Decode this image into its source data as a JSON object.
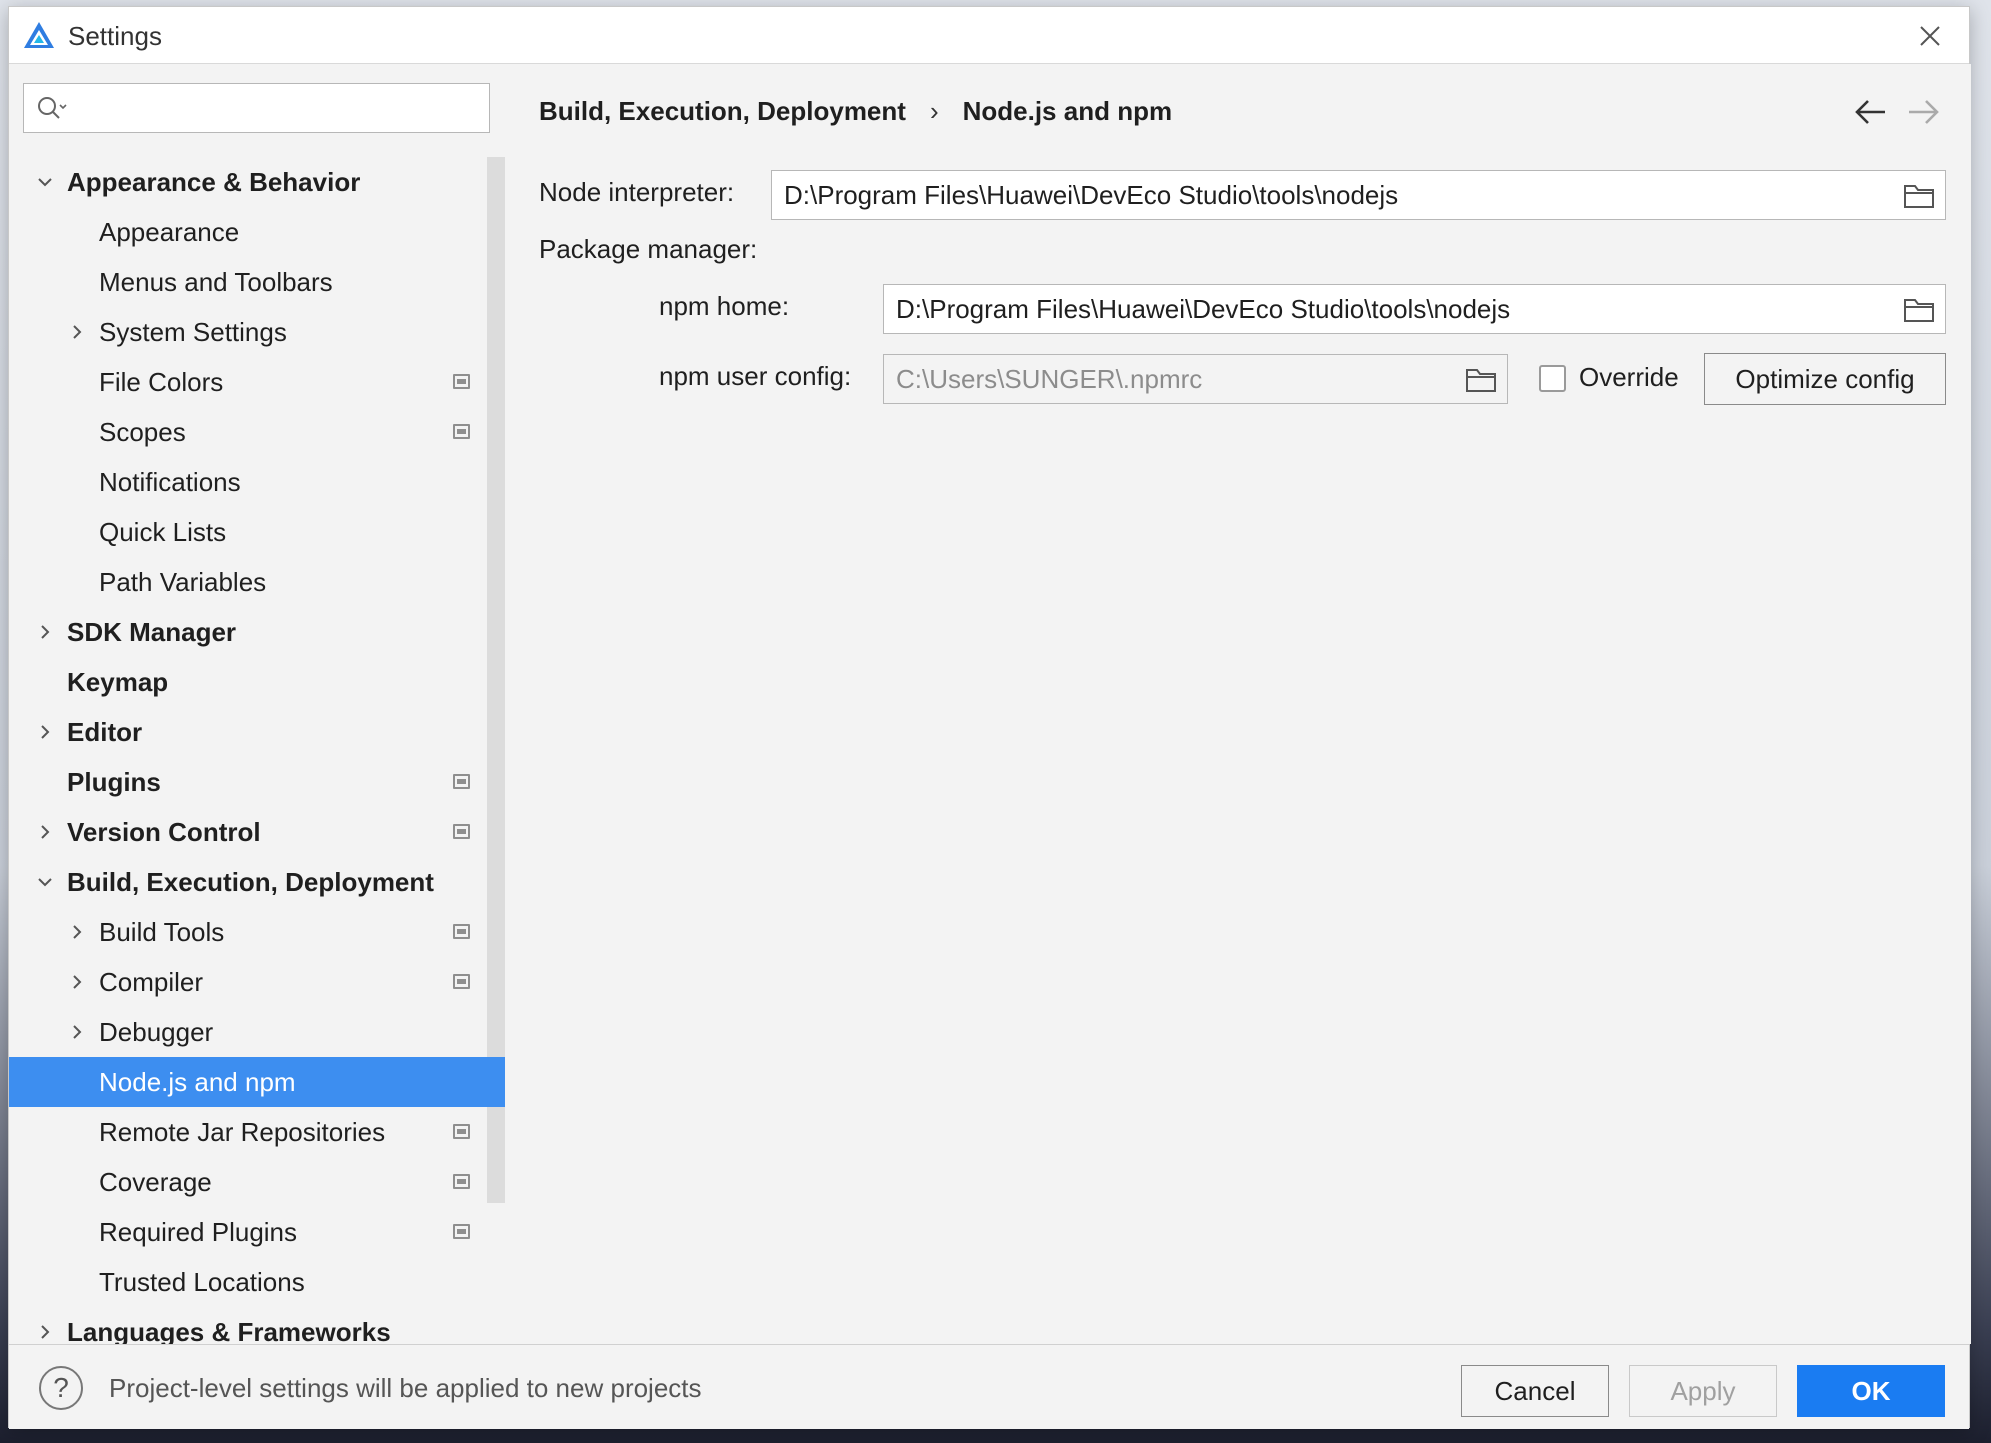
{
  "window": {
    "title": "Settings",
    "close_icon": "close-icon",
    "logo_icon": "deveco-logo"
  },
  "sidebar": {
    "search": {
      "value": "",
      "placeholder": ""
    },
    "items": [
      {
        "label": "Appearance & Behavior",
        "level": 0,
        "expanded": true,
        "has_children": true,
        "bold": true
      },
      {
        "label": "Appearance",
        "level": 1
      },
      {
        "label": "Menus and Toolbars",
        "level": 1
      },
      {
        "label": "System Settings",
        "level": 1,
        "has_children": true
      },
      {
        "label": "File Colors",
        "level": 1,
        "project_icon": true
      },
      {
        "label": "Scopes",
        "level": 1,
        "project_icon": true
      },
      {
        "label": "Notifications",
        "level": 1
      },
      {
        "label": "Quick Lists",
        "level": 1
      },
      {
        "label": "Path Variables",
        "level": 1
      },
      {
        "label": "SDK Manager",
        "level": 0,
        "has_children": true,
        "bold": true
      },
      {
        "label": "Keymap",
        "level": 0,
        "bold": true
      },
      {
        "label": "Editor",
        "level": 0,
        "has_children": true,
        "bold": true
      },
      {
        "label": "Plugins",
        "level": 0,
        "bold": true,
        "project_icon": true
      },
      {
        "label": "Version Control",
        "level": 0,
        "has_children": true,
        "bold": true,
        "project_icon": true
      },
      {
        "label": "Build, Execution, Deployment",
        "level": 0,
        "expanded": true,
        "has_children": true,
        "bold": true
      },
      {
        "label": "Build Tools",
        "level": 1,
        "has_children": true,
        "project_icon": true
      },
      {
        "label": "Compiler",
        "level": 1,
        "has_children": true,
        "project_icon": true
      },
      {
        "label": "Debugger",
        "level": 1,
        "has_children": true
      },
      {
        "label": "Node.js and npm",
        "level": 1,
        "selected": true
      },
      {
        "label": "Remote Jar Repositories",
        "level": 1,
        "project_icon": true
      },
      {
        "label": "Coverage",
        "level": 1,
        "project_icon": true
      },
      {
        "label": "Required Plugins",
        "level": 1,
        "project_icon": true
      },
      {
        "label": "Trusted Locations",
        "level": 1
      },
      {
        "label": "Languages & Frameworks",
        "level": 0,
        "has_children": true,
        "bold": true
      }
    ]
  },
  "breadcrumb": {
    "parent": "Build, Execution, Deployment",
    "separator": "›",
    "current": "Node.js and npm"
  },
  "form": {
    "node_interpreter_label": "Node interpreter:",
    "node_interpreter_value": "D:\\Program Files\\Huawei\\DevEco Studio\\tools\\nodejs",
    "package_manager_label": "Package manager:",
    "npm_home_label": "npm home:",
    "npm_home_value": "D:\\Program Files\\Huawei\\DevEco Studio\\tools\\nodejs",
    "npm_user_config_label": "npm user config:",
    "npm_user_config_value": "C:\\Users\\SUNGER\\.npmrc",
    "override_label": "Override",
    "override_checked": false,
    "optimize_config_label": "Optimize config"
  },
  "footer": {
    "help_symbol": "?",
    "message": "Project-level settings will be applied to new projects",
    "cancel_label": "Cancel",
    "apply_label": "Apply",
    "ok_label": "OK"
  },
  "colors": {
    "selection": "#3d8ef0",
    "primary_button": "#1a7cf2",
    "panel_background": "#f3f3f3"
  }
}
